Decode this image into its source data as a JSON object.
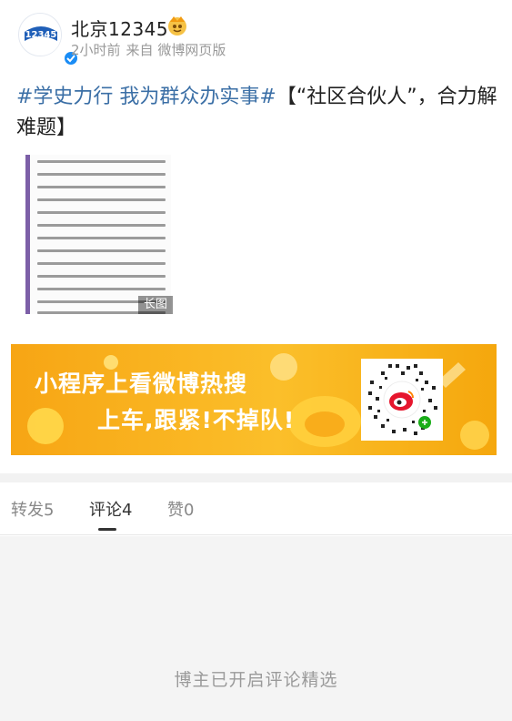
{
  "header": {
    "user_name": "北京12345",
    "avatar_text": "12345",
    "time": "2小时前",
    "source": "来自 微博网页版"
  },
  "post": {
    "hashtag": "#学史力行 我为群众办实事#",
    "text": "【“社区合伙人”，合力解难题】",
    "long_image_badge": "长图"
  },
  "banner": {
    "title": "小程序上看微博热搜",
    "subtitle": "上车,跟紧!不掉队!"
  },
  "tabs": [
    {
      "label": "转发5"
    },
    {
      "label": "评论4"
    },
    {
      "label": "赞0"
    }
  ],
  "comments": {
    "empty_note": "博主已开启评论精选"
  },
  "colors": {
    "hashtag": "#3b6fa6",
    "banner_start": "#f7a514",
    "banner_end": "#fbbf2a",
    "verified": "#1a8cf5"
  }
}
